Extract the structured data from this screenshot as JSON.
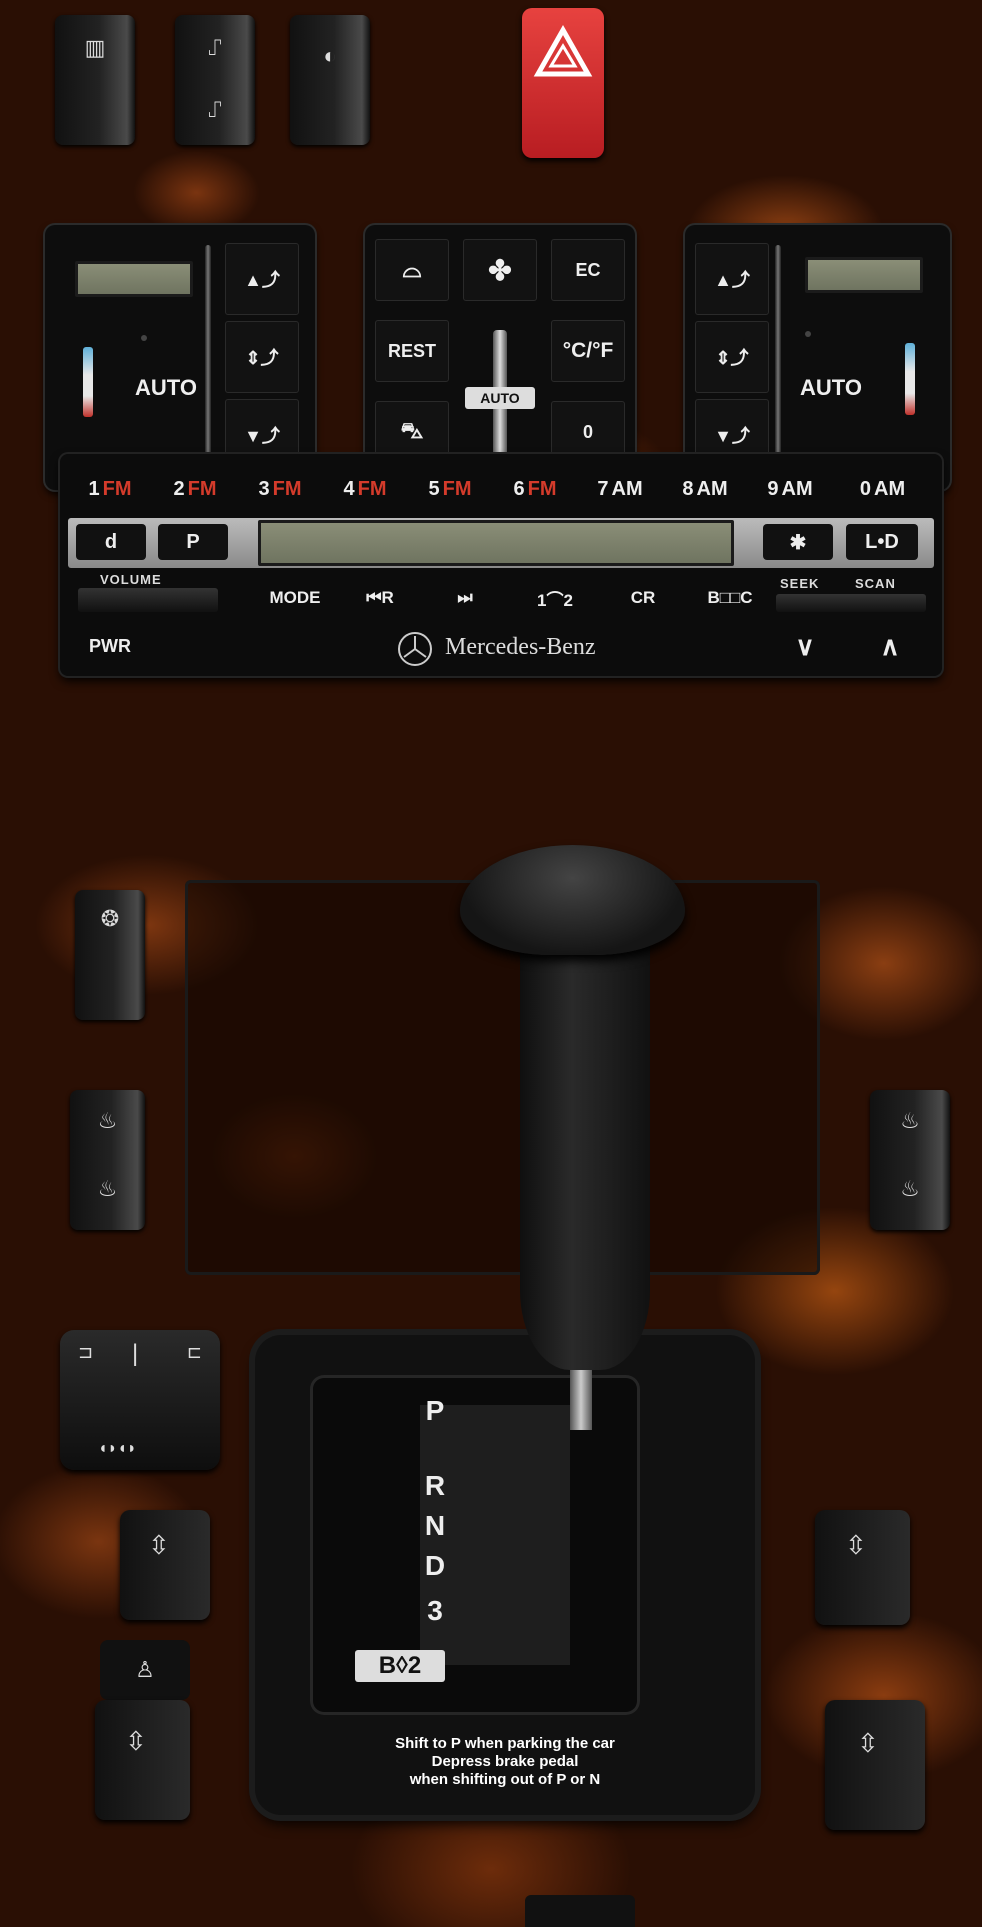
{
  "top_switches": {
    "rear_defrost_icon": "rear-defrost",
    "seat_memory_icon": "seat",
    "headlamp_icon": "headlamp-range",
    "hazard_icon": "hazard-triangle",
    "hazard_color": "#d9262b"
  },
  "climate": {
    "left": {
      "auto_label": "AUTO"
    },
    "center": {
      "rest_label": "REST",
      "ec_label": "EC",
      "cf_label": "°C/°F",
      "zero_label": "0",
      "auto_label": "AUTO"
    },
    "right": {
      "auto_label": "AUTO"
    }
  },
  "radio": {
    "presets": [
      {
        "num": "1",
        "band": "FM"
      },
      {
        "num": "2",
        "band": "FM"
      },
      {
        "num": "3",
        "band": "FM"
      },
      {
        "num": "4",
        "band": "FM"
      },
      {
        "num": "5",
        "band": "FM"
      },
      {
        "num": "6",
        "band": "FM"
      },
      {
        "num": "7",
        "band": "AM"
      },
      {
        "num": "8",
        "band": "AM"
      },
      {
        "num": "9",
        "band": "AM"
      },
      {
        "num": "0",
        "band": "AM"
      }
    ],
    "left_key_1": "d",
    "left_key_2": "P",
    "star_key": "✱",
    "ld_key": "L•D",
    "volume_label": "VOLUME",
    "pwr_label": "PWR",
    "functions": [
      "MODE",
      "⏮R",
      "⏭",
      "1⌒2",
      "CR",
      "B□□C"
    ],
    "seek_label": "SEEK",
    "scan_label": "SCAN",
    "down_key": "∨",
    "up_key": "∧",
    "brand": "Mercedes-Benz"
  },
  "shifter": {
    "positions": [
      "P",
      "R",
      "N",
      "D",
      "3",
      "B◊2"
    ],
    "caption_line1": "Shift to P when parking the car",
    "caption_line2": "Depress brake pedal",
    "caption_line3": "when shifting out of P or N"
  }
}
